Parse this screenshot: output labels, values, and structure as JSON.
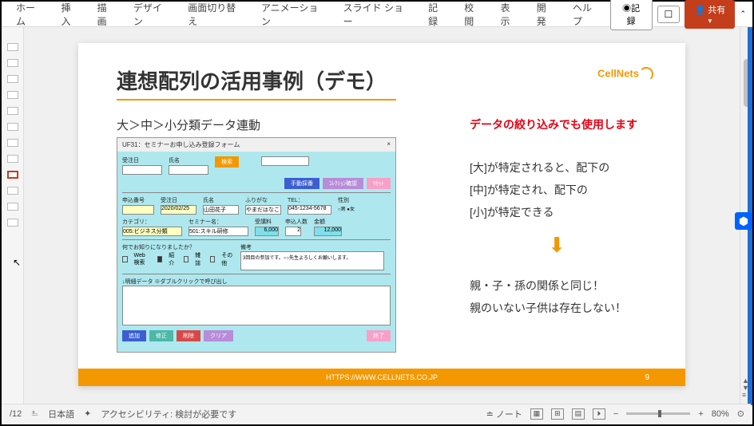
{
  "ribbon": {
    "tabs": [
      "ホーム",
      "挿入",
      "描画",
      "デザイン",
      "画面切り替え",
      "アニメーション",
      "スライド ショー",
      "記録",
      "校閲",
      "表示",
      "開発",
      "ヘルプ"
    ],
    "record": "◉記録",
    "share": "共有"
  },
  "slide": {
    "title": "連想配列の活用事例（デモ）",
    "logo": "CellNets",
    "subtitle": "大＞中＞小分類データ連動",
    "red_line": "データの絞り込みでも使用します",
    "form": {
      "window_title": "UF31：セミナーお申し込み登録フォーム",
      "close": "×",
      "labels": {
        "date": "受注日",
        "name": "氏名",
        "search": "検索",
        "manual": "手動採番",
        "coll": "ｺﾚｸｼｮﾝ確認",
        "reset": "ﾘｾｯﾄ",
        "order_no": "申込番号",
        "date2": "受注日",
        "name2": "氏名",
        "furigana": "ふりがな",
        "tel": "TEL：",
        "gender": "性別",
        "category": "カテゴリ：",
        "seminar": "セミナー名：",
        "fee": "受講料",
        "count": "申込人数",
        "total": "金額",
        "source": "何でお知りになりましたか？",
        "remarks": "備考",
        "web": "Web検索",
        "intro": "紹介",
        "mag": "雑誌",
        "other": "その他",
        "detail": "↓明細データ ※ダブルクリックで呼び出し",
        "add": "追加",
        "edit": "修正",
        "del": "削除",
        "clear": "クリア",
        "end": "終了"
      },
      "values": {
        "date2": "2020/02/25",
        "name2": "山田花子",
        "furigana": "やまだはなこ",
        "tel": "045-1234-5678",
        "category": "005:ビジネス分類",
        "seminar": "501:スキル研修",
        "fee": "6,000",
        "count": "2",
        "total": "12,000",
        "remarks_text": "3回目の参加です。○○先生よろしくお願いします。",
        "male": "男",
        "female": "女"
      }
    },
    "right1_1": "[大]が特定されると、配下の",
    "right1_2": "[中]が特定され、配下の",
    "right1_3": "[小]が特定できる",
    "arrow": "⬇",
    "right2_1": "親・子・孫の関係と同じ！",
    "right2_2": "親のいない子供は存在しない！",
    "footer_url": "HTTPS://WWW.CELLNETS.CO.JP",
    "page": "9"
  },
  "status": {
    "slide_count": "/12",
    "lang": "日本語",
    "a11y": "アクセシビリティ: 検討が必要です",
    "notes": "ノート",
    "zoom": "80%"
  }
}
